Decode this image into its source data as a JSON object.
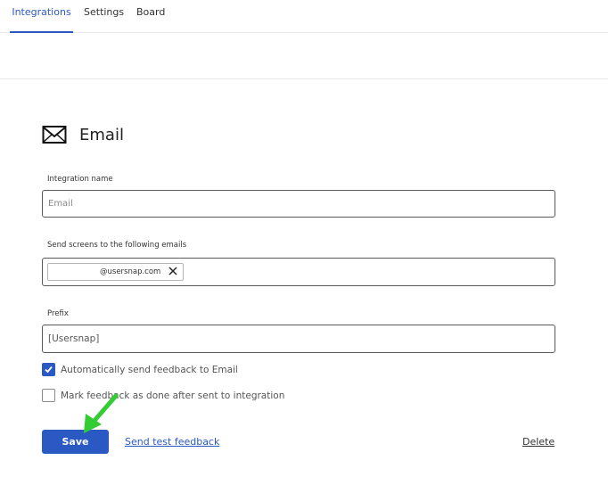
{
  "tabs": [
    {
      "label": "Integrations",
      "active": true
    },
    {
      "label": "Settings",
      "active": false
    },
    {
      "label": "Board",
      "active": false
    }
  ],
  "section": {
    "title": "Email",
    "icon": "mail-icon"
  },
  "form": {
    "integration_name": {
      "label": "Integration name",
      "placeholder": "Email",
      "value": ""
    },
    "emails": {
      "label": "Send screens to the following emails",
      "tags": [
        {
          "text": "@usersnap.com"
        }
      ]
    },
    "prefix": {
      "label": "Prefix",
      "value": "[Usersnap]"
    },
    "checkboxes": [
      {
        "label": "Automatically send feedback to Email",
        "checked": true
      },
      {
        "label": "Mark feedback as done after sent to integration",
        "checked": false
      }
    ]
  },
  "actions": {
    "save_label": "Save",
    "test_label": "Send test feedback",
    "delete_label": "Delete"
  },
  "colors": {
    "accent": "#2b59c3",
    "annotation_arrow": "#33cc33"
  }
}
